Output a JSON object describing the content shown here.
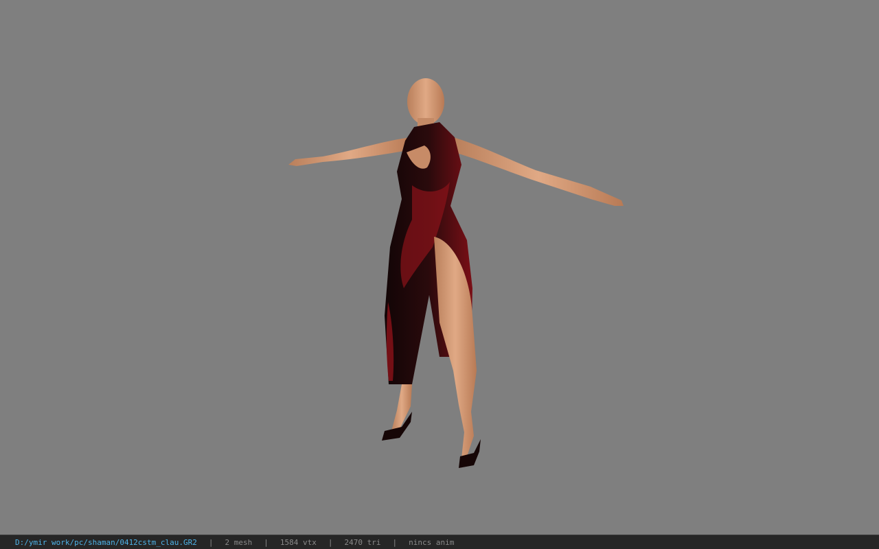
{
  "viewport": {
    "background_color": "#7f7f7f",
    "model_icon": "character-model-icon"
  },
  "statusbar": {
    "file_path": "D:/ymir work/pc/shaman/0412cstm_clau.GR2",
    "separator": "|",
    "mesh_count": "2 mesh",
    "vertex_count": "1584 vtx",
    "triangle_count": "2470 tri",
    "anim_status": "nincs anim",
    "path_color": "#4fb3e8",
    "text_color": "#8a8a8a"
  }
}
